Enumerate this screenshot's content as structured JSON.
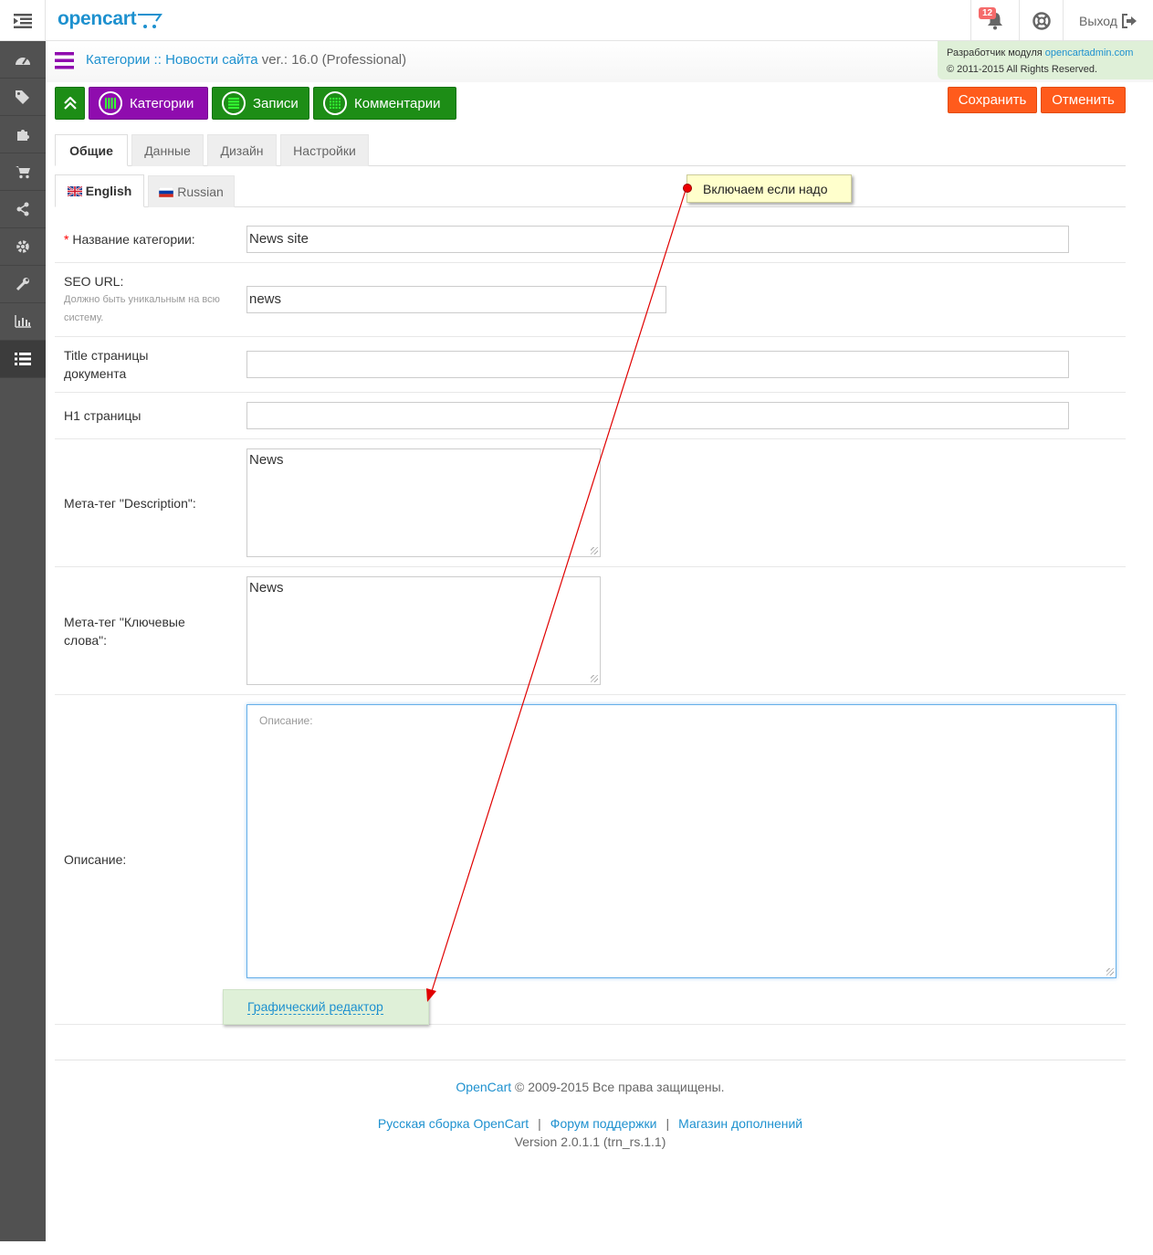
{
  "header": {
    "logo": "opencart",
    "alerts_count": "12",
    "logout_label": "Выход"
  },
  "sidebar": {
    "items": [
      {
        "icon": "dashboard-icon"
      },
      {
        "icon": "tag-icon"
      },
      {
        "icon": "puzzle-icon"
      },
      {
        "icon": "cart-icon"
      },
      {
        "icon": "share-icon"
      },
      {
        "icon": "gear-icon"
      },
      {
        "icon": "wrench-icon"
      },
      {
        "icon": "bar-chart-icon"
      },
      {
        "icon": "list-icon",
        "active": true
      }
    ]
  },
  "module": {
    "crumb_1": "Категории",
    "crumb_sep": " :: ",
    "crumb_2": "Новости сайта",
    "version": " ver.: 16.0 (Professional)",
    "dev_label": "Разработчик модуля ",
    "dev_link": "opencartadmin.com",
    "copyright": "© 2011-2015 All Rights Reserved."
  },
  "toolbar": {
    "categories": "Категории",
    "records": "Записи",
    "comments": "Комментарии",
    "save": "Сохранить",
    "cancel": "Отменить"
  },
  "tabs": [
    "Общие",
    "Данные",
    "Дизайн",
    "Настройки"
  ],
  "lang_tabs": [
    "English",
    "Russian"
  ],
  "form": {
    "name_label": "Название категории:",
    "name_required": "*",
    "name_value": "News site",
    "seo_label": "SEO URL:",
    "seo_help": "Должно быть уникальным на всю систему.",
    "seo_value": "news",
    "title_label": "Title страницы документа",
    "title_value": "",
    "h1_label": "H1 страницы",
    "h1_value": "",
    "meta_desc_label": "Мета-тег \"Description\":",
    "meta_desc_value": "News",
    "meta_kw_label": "Мета-тег \"Ключевые слова\":",
    "meta_kw_value": "News",
    "desc_label": "Описание:",
    "desc_placeholder": "Описание:",
    "wysiwyg_link": "Графический редактор"
  },
  "annotation": {
    "callout": "Включаем если надо",
    "arrow_color": "#e00000"
  },
  "footer": {
    "brand": "OpenCart",
    "rights": " © 2009-2015 Все права защищены.",
    "link_1": "Русская сборка OpenCart",
    "link_2": "Форум поддержки",
    "link_3": "Магазин дополнений",
    "version": "Version 2.0.1.1 (trn_rs.1.1)"
  },
  "colors": {
    "accent": "#1e91cf",
    "green_button": "#1d8d16",
    "purple_button": "#8f0cae",
    "orange_button": "#ff5b1c",
    "sidebar": "#515151"
  }
}
